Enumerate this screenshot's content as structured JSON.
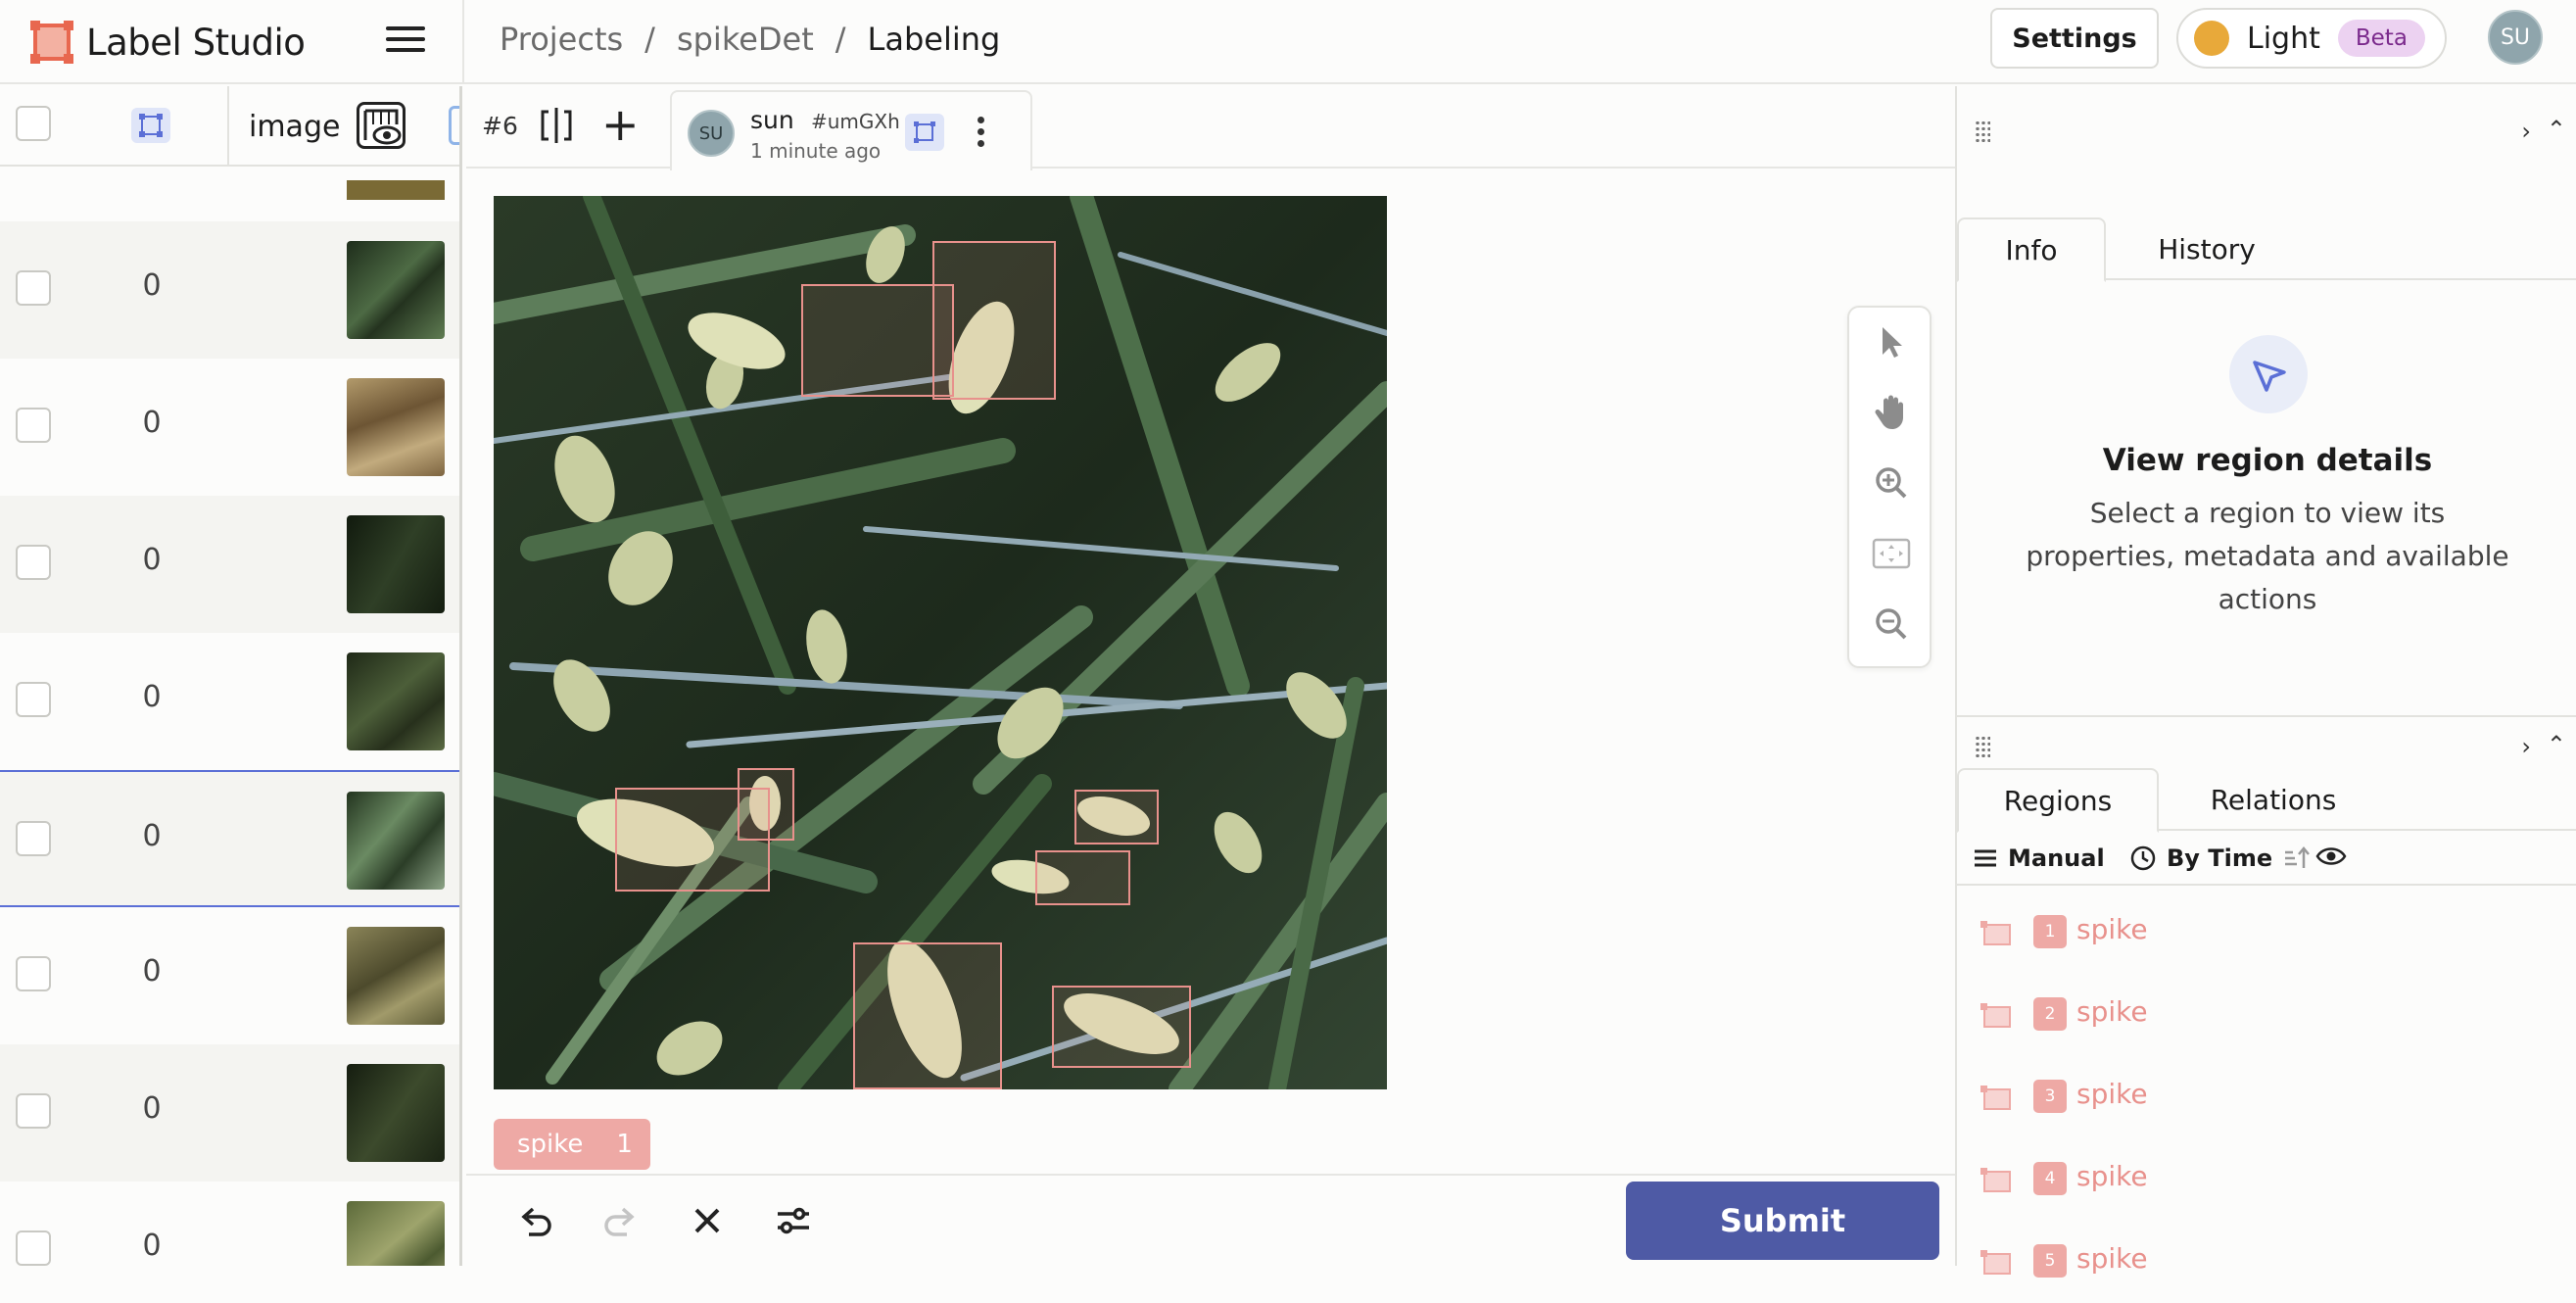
{
  "app": {
    "title": "Label Studio",
    "breadcrumb": [
      "Projects",
      "spikeDet",
      "Labeling"
    ],
    "breadcrumb_sep": "/",
    "settings_label": "Settings",
    "theme_label": "Light",
    "beta_label": "Beta",
    "user_initials": "SU",
    "brand_color": "#e8674f",
    "accent_color": "#4e5aa5"
  },
  "left_pane": {
    "column_label": "image",
    "rows": [
      {
        "count": "0",
        "thumb_color": "#2d3f2a"
      },
      {
        "count": "0",
        "thumb_color": "#8b7653"
      },
      {
        "count": "0",
        "thumb_color": "#1c2618"
      },
      {
        "count": "0",
        "thumb_color": "#2e3a25"
      },
      {
        "count": "0",
        "thumb_color": "#3c5238"
      },
      {
        "count": "0",
        "thumb_color": "#6e6a45"
      },
      {
        "count": "0",
        "thumb_color": "#2a3421"
      },
      {
        "count": "0",
        "thumb_color": "#747a4a"
      }
    ]
  },
  "annotation": {
    "task_id": "#6",
    "user": "sun",
    "hash": "#umGXh",
    "time": "1 minute ago",
    "avatar_initials": "SU"
  },
  "canvas": {
    "label_chip": {
      "label": "spike",
      "hotkey": "1"
    },
    "submit_label": "Submit"
  },
  "info_panel": {
    "tabs": [
      "Info",
      "History"
    ],
    "title": "View region details",
    "description": "Select a region to view its properties, metadata and available actions"
  },
  "regions_panel": {
    "tabs": [
      "Regions",
      "Relations"
    ],
    "filters": {
      "manual": "Manual",
      "by_time": "By Time"
    },
    "items": [
      {
        "num": "1",
        "label": "spike"
      },
      {
        "num": "2",
        "label": "spike"
      },
      {
        "num": "3",
        "label": "spike"
      },
      {
        "num": "4",
        "label": "spike"
      },
      {
        "num": "5",
        "label": "spike"
      }
    ]
  }
}
